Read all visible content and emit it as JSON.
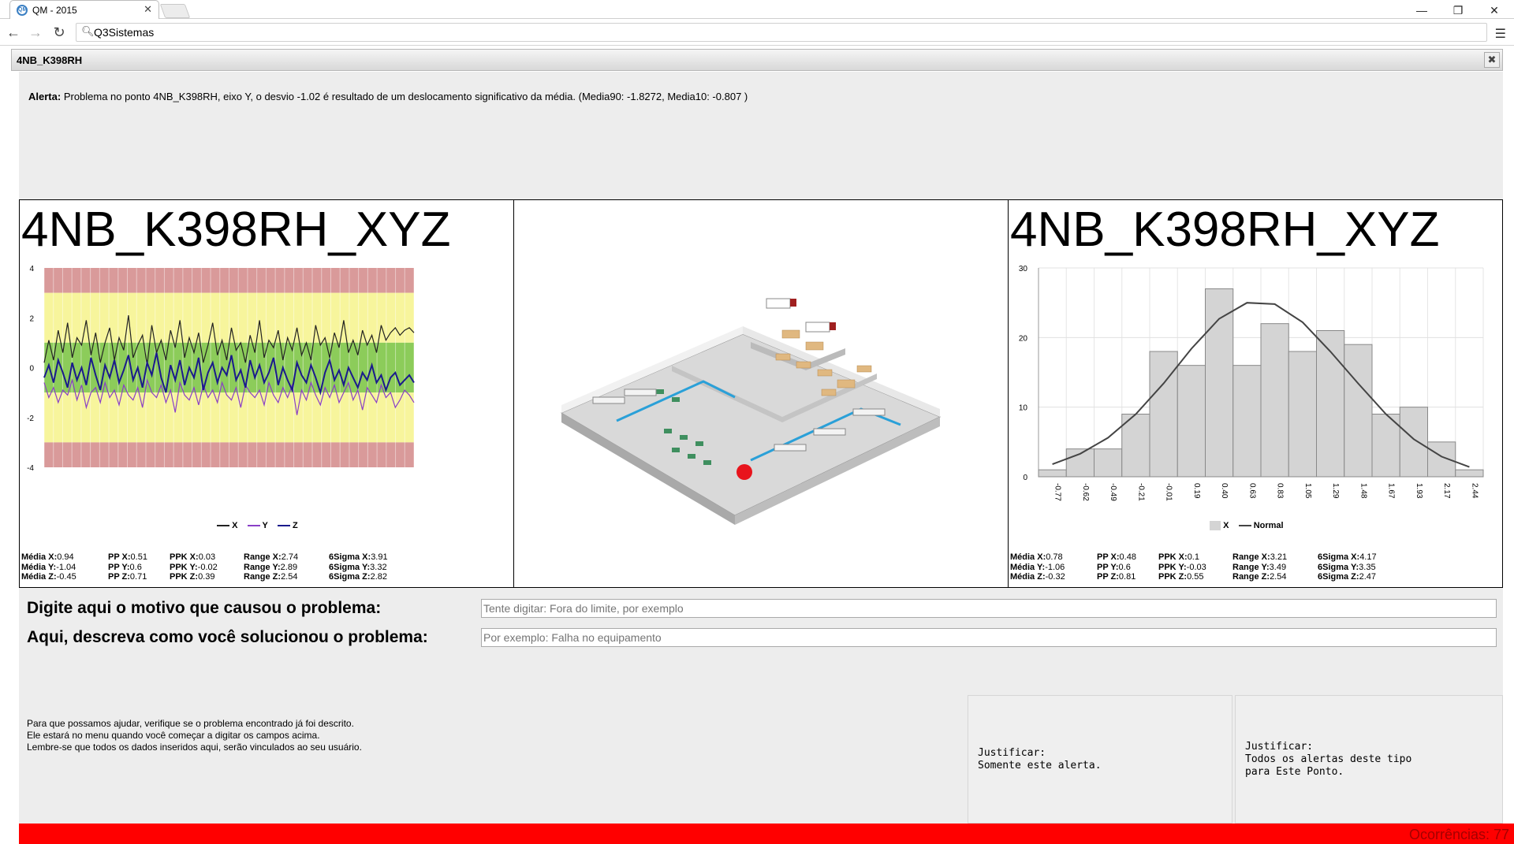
{
  "browser": {
    "tab_title": "QM - 2015",
    "tab_icon": "qm-favicon-icon",
    "url": "Q3Sistemas",
    "window_controls": [
      "minimize",
      "restore",
      "close"
    ]
  },
  "dialog": {
    "title": "4NB_K398RH"
  },
  "alert": {
    "label": "Alerta:",
    "text": "Problema no ponto 4NB_K398RH, eixo Y, o desvio -1.02 é resultado de um deslocamento significativo da média. (Media90: -1.8272, Media10: -0.807 )"
  },
  "left_panel": {
    "title": "4NB_K398RH_XYZ",
    "stats": [
      [
        "Média X:",
        "0.94",
        "PP X:",
        "0.51",
        "PPK X:",
        "0.03",
        "Range X:",
        "2.74",
        "6Sigma X:",
        "3.91"
      ],
      [
        "Média Y:",
        "-1.04",
        "PP Y:",
        "0.6",
        "PPK Y:",
        "-0.02",
        "Range Y:",
        "2.89",
        "6Sigma Y:",
        "3.32"
      ],
      [
        "Média Z:",
        "-0.45",
        "PP Z:",
        "0.71",
        "PPK Z:",
        "0.39",
        "Range Z:",
        "2.54",
        "6Sigma Z:",
        "2.82"
      ]
    ]
  },
  "right_panel": {
    "title": "4NB_K398RH_XYZ",
    "stats": [
      [
        "Média X:",
        "0.78",
        "PP X:",
        "0.48",
        "PPK X:",
        "0.1",
        "Range X:",
        "3.21",
        "6Sigma X:",
        "4.17"
      ],
      [
        "Média Y:",
        "-1.06",
        "PP Y:",
        "0.6",
        "PPK Y:",
        "-0.03",
        "Range Y:",
        "3.49",
        "6Sigma Y:",
        "3.35"
      ],
      [
        "Média Z:",
        "-0.32",
        "PP Z:",
        "0.81",
        "PPK Z:",
        "0.55",
        "Range Z:",
        "2.54",
        "6Sigma Z:",
        "2.47"
      ]
    ]
  },
  "chart_data": [
    {
      "type": "line",
      "ylim": [
        -4,
        4
      ],
      "yticks": [
        "4",
        "2",
        "0",
        "-2",
        "-4"
      ],
      "bands": [
        {
          "from": 3,
          "to": 4,
          "color": "#d99a9a"
        },
        {
          "from": 1,
          "to": 3,
          "color": "#f7f59c"
        },
        {
          "from": -1,
          "to": 1,
          "color": "#8ccc5a"
        },
        {
          "from": -3,
          "to": -1,
          "color": "#f7f59c"
        },
        {
          "from": -4,
          "to": -3,
          "color": "#d99a9a"
        }
      ],
      "legend": "bottom-center",
      "series": [
        {
          "name": "X",
          "color": "#222222",
          "values": [
            0.2,
            1.1,
            0.3,
            1.5,
            0.6,
            1.8,
            0.4,
            1.2,
            0.9,
            1.9,
            0.5,
            1.4,
            0.2,
            1.0,
            1.6,
            0.3,
            1.2,
            0.7,
            2.1,
            0.4,
            0.9,
            1.3,
            0.1,
            1.7,
            0.6,
            1.1,
            0.3,
            1.5,
            0.8,
            1.9,
            0.4,
            1.2,
            0.6,
            1.4,
            0.2,
            0.9,
            1.8,
            0.5,
            1.1,
            0.3,
            1.6,
            0.7,
            1.0,
            0.2,
            1.3,
            0.6,
            1.9,
            0.4,
            1.1,
            0.8,
            1.5,
            0.3,
            1.2,
            0.7,
            1.6,
            0.5,
            1.0,
            0.3,
            1.7,
            0.9,
            1.2,
            0.4,
            1.4,
            0.8,
            1.9,
            0.6,
            1.1,
            0.5,
            1.5,
            0.9,
            1.3,
            0.6,
            1.7,
            1.1,
            1.4,
            1.6,
            1.3,
            1.5,
            1.6,
            1.4
          ]
        },
        {
          "name": "Y",
          "color": "#8a3fc7",
          "values": [
            -0.6,
            -1.2,
            -0.8,
            -1.4,
            -0.9,
            -1.1,
            -0.5,
            -1.3,
            -0.7,
            -1.6,
            -1.0,
            -0.8,
            -1.4,
            -0.6,
            -1.2,
            -0.9,
            -1.5,
            -0.7,
            -1.1,
            -1.3,
            -0.8,
            -1.6,
            -0.5,
            -1.0,
            -1.2,
            -0.7,
            -1.4,
            -0.9,
            -1.8,
            -0.6,
            -1.1,
            -1.3,
            -0.8,
            -1.5,
            -0.7,
            -1.2,
            -0.9,
            -1.4,
            -0.6,
            -1.1,
            -1.3,
            -0.8,
            -1.6,
            -0.7,
            -1.0,
            -1.2,
            -0.9,
            -1.5,
            -0.6,
            -1.1,
            -1.4,
            -0.8,
            -1.2,
            -0.7,
            -1.9,
            -0.9,
            -1.3,
            -0.6,
            -1.1,
            -1.5,
            -0.8,
            -1.2,
            -0.7,
            -1.4,
            -1.0,
            -0.6,
            -1.3,
            -0.9,
            -1.7,
            -0.8,
            -1.1,
            -1.4,
            -0.7,
            -1.2,
            -1.0,
            -1.6,
            -1.3,
            -0.9,
            -1.1,
            -1.4
          ]
        },
        {
          "name": "Z",
          "color": "#1a1a8c",
          "values": [
            -0.4,
            0.1,
            -0.6,
            0.3,
            -0.2,
            -0.8,
            0.2,
            -0.5,
            0.0,
            -0.7,
            0.4,
            -0.3,
            -0.9,
            0.1,
            -0.4,
            0.3,
            -0.6,
            -0.1,
            0.5,
            -0.5,
            0.0,
            -0.8,
            0.2,
            -0.3,
            0.6,
            -0.4,
            -1.0,
            0.1,
            -0.5,
            0.3,
            -0.7,
            0.0,
            -0.4,
            0.4,
            -0.9,
            -0.2,
            0.2,
            -0.6,
            0.0,
            -0.3,
            0.5,
            -0.5,
            -0.1,
            -0.8,
            0.3,
            -0.4,
            0.1,
            -0.6,
            -0.2,
            0.4,
            -0.7,
            0.0,
            -0.5,
            -0.9,
            0.2,
            -0.3,
            -0.6,
            0.1,
            -0.4,
            -1.0,
            -0.2,
            0.3,
            -0.5,
            -0.1,
            -0.7,
            0.0,
            -0.4,
            -0.8,
            -0.2,
            -0.5,
            0.1,
            -0.6,
            -0.3,
            -0.9,
            -0.4,
            -0.2,
            -0.7,
            -0.5,
            -0.3,
            -0.6
          ]
        }
      ]
    },
    {
      "type": "bar",
      "ylim": [
        0,
        30
      ],
      "yticks": [
        "30",
        "20",
        "10",
        "0"
      ],
      "categories": [
        "-0.77",
        "-0.62",
        "-0.49",
        "-0.21",
        "-0.01",
        "0.19",
        "0.40",
        "0.63",
        "0.83",
        "1.05",
        "1.29",
        "1.48",
        "1.67",
        "1.93",
        "2.17",
        "2.44"
      ],
      "legend": "bottom-center",
      "series": [
        {
          "name": "X",
          "color": "#d4d4d4",
          "values": [
            1,
            4,
            4,
            9,
            18,
            16,
            27,
            16,
            22,
            18,
            21,
            19,
            9,
            10,
            5,
            1
          ]
        },
        {
          "name": "Normal",
          "color": "#444444",
          "type": "line",
          "values": [
            1.8,
            3.3,
            5.6,
            9.0,
            13.4,
            18.4,
            22.7,
            25.0,
            24.8,
            22.2,
            18.0,
            13.4,
            9.0,
            5.4,
            2.9,
            1.4
          ]
        }
      ]
    }
  ],
  "form": {
    "q1_label": "Digite aqui o motivo que causou o problema:",
    "q1_placeholder": "Tente digitar: Fora do limite, por exemplo",
    "q2_label": "Aqui, descreva como você solucionou o problema:",
    "q2_placeholder": "Por exemplo: Falha no equipamento"
  },
  "help": {
    "line1": "Para que possamos ajudar, verifique se o problema encontrado já foi descrito.",
    "line2": "Ele estará no menu quando você começar a digitar os campos acima.",
    "line3": "Lembre-se que todos os dados inseridos aqui, serão vinculados ao seu usuário."
  },
  "justify": {
    "one": {
      "l1": "Justificar:",
      "l2": "Somente este alerta."
    },
    "all": {
      "l1": "Justificar:",
      "l2": "Todos os alertas deste tipo",
      "l3": "para Este Ponto."
    }
  },
  "footer": {
    "occurrences": "Ocorrências: 77"
  },
  "factory_image": {
    "icon": "factory-isometric-layout-image",
    "marker_color": "#e8141c"
  }
}
